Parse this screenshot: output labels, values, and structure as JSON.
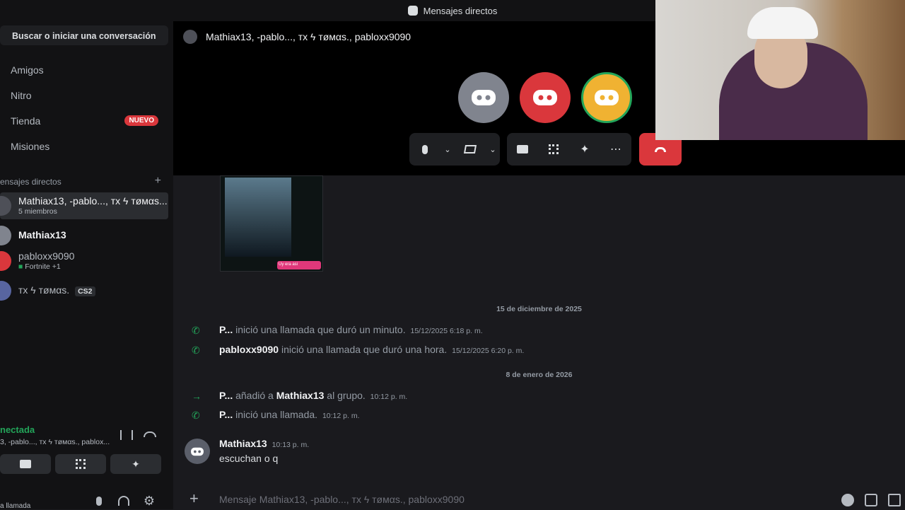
{
  "window": {
    "title": "Mensajes directos"
  },
  "sidebar": {
    "search_label": "Buscar o iniciar una conversación",
    "nav": [
      {
        "label": "Amigos",
        "icon": "friends-icon"
      },
      {
        "label": "Nitro",
        "icon": "nitro-icon"
      },
      {
        "label": "Tienda",
        "icon": "shop-icon",
        "badge": "NUEVO"
      },
      {
        "label": "Misiones",
        "icon": "quests-icon"
      }
    ],
    "dm_header": "ensajes directos",
    "dm_header_add": "+",
    "dms": [
      {
        "name": "Mathiax13, -pablo..., тх ϟ тøмαs...",
        "sub": "5 miembros",
        "active": true
      },
      {
        "name": "Mathiax13",
        "sub": ""
      },
      {
        "name": "pabloxx9090",
        "sub": "Fortnite +1"
      },
      {
        "name": "тх ϟ тøмαs.",
        "sub": "",
        "tag": "CS2"
      }
    ],
    "voice": {
      "status": "nectada",
      "channel": "3, -pablo..., тх ϟ тøмαs., pablox..."
    },
    "user_bar_text": "a llamada"
  },
  "call": {
    "title": "Mathiax13, -pablo..., тх ϟ тøмαs., pabloxx9090",
    "participants": [
      {
        "color": "#80848e"
      },
      {
        "color": "#da373c"
      },
      {
        "color": "#f0b232",
        "speaking": true
      }
    ],
    "accent_speaking": "#23a55a"
  },
  "thumbnail": {
    "bubble_text": "Uy era asi"
  },
  "chat": {
    "date1": "15 de diciembre de 2025",
    "sys1": {
      "who": "P...",
      "text": "inició una llamada que duró un minuto.",
      "time": "15/12/2025 6:18 p. m."
    },
    "sys2": {
      "who": "pabloxx9090",
      "text": "inició una llamada que duró una hora.",
      "time": "15/12/2025 6:20 p. m."
    },
    "date2": "8 de enero de 2026",
    "sys3": {
      "who": "P...",
      "text_a": "añadió a",
      "target": "Mathiax13",
      "text_b": "al grupo.",
      "time": "10:12 p. m."
    },
    "sys4": {
      "who": "P...",
      "text": "inició una llamada.",
      "time": "10:12 p. m."
    },
    "message": {
      "author": "Mathiax13",
      "time": "10:13 p. m.",
      "content": "escuchan o q"
    }
  },
  "composer": {
    "placeholder": "Mensaje Mathiax13, -pablo..., тх ϟ тøмαs., pabloxx9090"
  }
}
